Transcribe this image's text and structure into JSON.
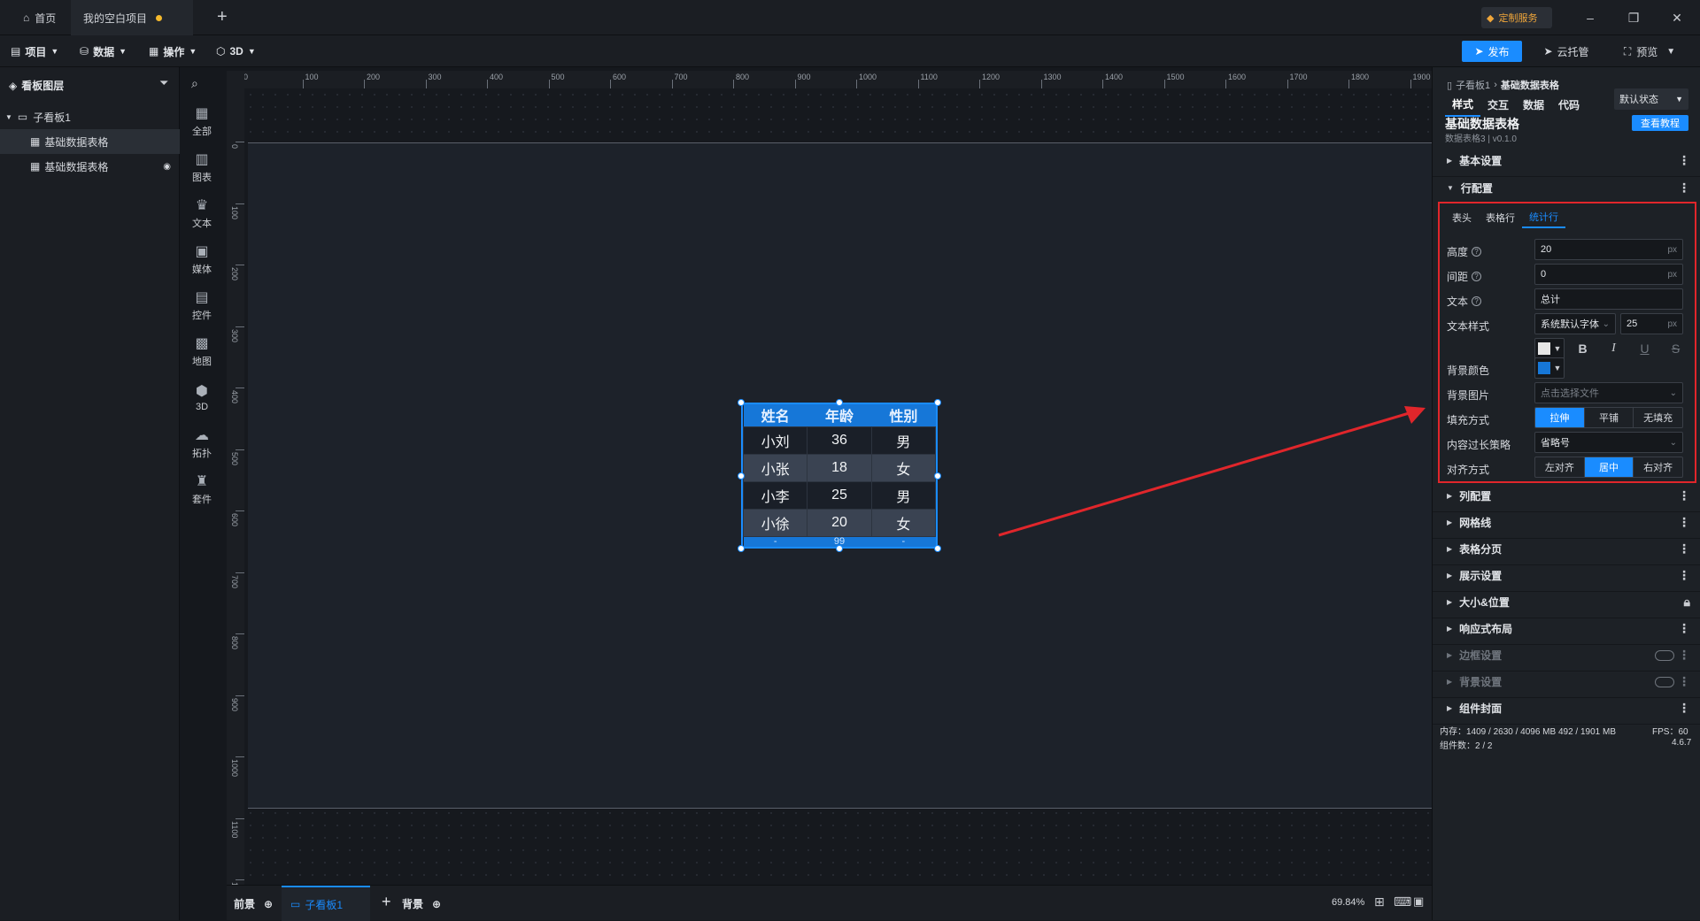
{
  "titlebar": {
    "tabs": [
      {
        "label": "首页"
      },
      {
        "label": "我的空白项目"
      }
    ],
    "custom_service": "定制服务"
  },
  "menubar": {
    "menus": [
      {
        "label": "项目"
      },
      {
        "label": "数据"
      },
      {
        "label": "操作"
      },
      {
        "label": "3D"
      }
    ],
    "publish": "发布",
    "cloud": "云托管",
    "preview": "预览"
  },
  "layers": {
    "title": "看板图层",
    "items": [
      {
        "label": "子看板1"
      },
      {
        "label": "基础数据表格"
      },
      {
        "label": "基础数据表格"
      }
    ]
  },
  "components": [
    {
      "label": "全部",
      "icon": "grid-icon"
    },
    {
      "label": "图表",
      "icon": "bar-chart-icon"
    },
    {
      "label": "文本",
      "icon": "text-icon"
    },
    {
      "label": "媒体",
      "icon": "media-icon"
    },
    {
      "label": "控件",
      "icon": "control-icon"
    },
    {
      "label": "地图",
      "icon": "map-icon"
    },
    {
      "label": "3D",
      "icon": "cube-icon"
    },
    {
      "label": "拓扑",
      "icon": "topology-icon"
    },
    {
      "label": "套件",
      "icon": "kit-icon"
    }
  ],
  "ruler": {
    "top": [
      "0",
      "100",
      "200",
      "300",
      "400",
      "500",
      "600",
      "700",
      "800",
      "900",
      "1000",
      "1100",
      "1200",
      "1300",
      "1400",
      "1500",
      "1600",
      "1700",
      "1800",
      "1900"
    ],
    "left": [
      "0",
      "100",
      "200",
      "300",
      "400",
      "500",
      "600",
      "700",
      "800",
      "900",
      "1000",
      "1100",
      "1200"
    ]
  },
  "table": {
    "headers": [
      "姓名",
      "年龄",
      "性别"
    ],
    "rows": [
      [
        "小刘",
        "36",
        "男"
      ],
      [
        "小张",
        "18",
        "女"
      ],
      [
        "小李",
        "25",
        "男"
      ],
      [
        "小徐",
        "20",
        "女"
      ]
    ],
    "total": [
      "-",
      "99",
      "-"
    ]
  },
  "bottombar": {
    "foreground": "前景",
    "board_tab": "子看板1",
    "background": "背景",
    "zoom": "69.84%"
  },
  "panel": {
    "breadcrumb_parent": "子看板1",
    "breadcrumb_current": "基础数据表格",
    "tabs": [
      "样式",
      "交互",
      "数据",
      "代码"
    ],
    "state": "默认状态",
    "comp_name": "基础数据表格",
    "comp_meta": "数据表格3 | v0.1.0",
    "tutorial": "查看教程",
    "sections_top": [
      {
        "label": "基本设置"
      },
      {
        "label": "行配置"
      }
    ],
    "row_tabs": [
      "表头",
      "表格行",
      "统计行"
    ],
    "fields": {
      "height_label": "高度",
      "height_value": "20",
      "unit": "px",
      "gap_label": "间距",
      "gap_value": "0",
      "text_label": "文本",
      "text_value": "总计",
      "style_label": "文本样式",
      "font_value": "系统默认字体",
      "font_size": "25",
      "bg_color_label": "背景颜色",
      "bg_image_label": "背景图片",
      "bg_image_placeholder": "点击选择文件",
      "fill_label": "填充方式",
      "fill_options": [
        "拉伸",
        "平铺",
        "无填充"
      ],
      "overflow_label": "内容过长策略",
      "overflow_value": "省略号",
      "align_label": "对齐方式",
      "align_options": [
        "左对齐",
        "居中",
        "右对齐"
      ]
    },
    "sections_bottom": [
      {
        "label": "列配置"
      },
      {
        "label": "网格线"
      },
      {
        "label": "表格分页"
      },
      {
        "label": "展示设置"
      },
      {
        "label": "大小&位置"
      },
      {
        "label": "响应式布局"
      },
      {
        "label": "边框设置"
      },
      {
        "label": "背景设置"
      },
      {
        "label": "组件封面"
      }
    ],
    "status": {
      "memory": "内存：1409 / 2630 / 4096 MB  492 / 1901 MB",
      "fps": "FPS：60",
      "count": "组件数：2 / 2",
      "version": "4.6.7"
    }
  },
  "colors": {
    "accent": "#1a8cff",
    "highlight_box": "#e0262b",
    "arrow": "#e0262b"
  }
}
